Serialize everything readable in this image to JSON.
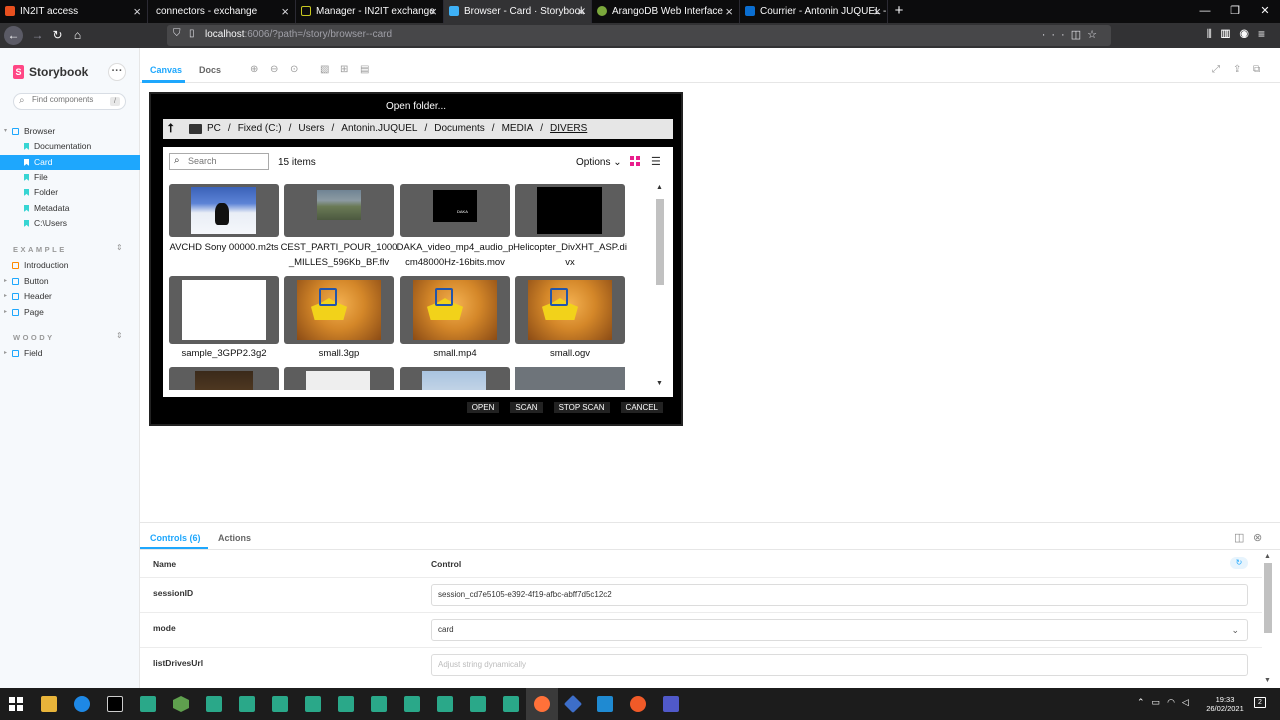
{
  "browser": {
    "tabs": [
      {
        "title": "IN2IT access",
        "color": "#e8501f"
      },
      {
        "title": "connectors - exchange",
        "color": "#0c0c0d"
      },
      {
        "title": "Manager - IN2IT exchange",
        "color": "#c8c820"
      },
      {
        "title": "Browser - Card · Storybook",
        "color": "#3eb1f7"
      },
      {
        "title": "ArangoDB Web Interface",
        "color": "#7ba83c"
      },
      {
        "title": "Courrier - Antonin JUQUEL - O...",
        "color": "#0a6ed1"
      }
    ],
    "url": {
      "host": "localhost",
      "rest": ":6006/?path=/story/browser--card"
    }
  },
  "sidebar": {
    "brand": "Storybook",
    "search_placeholder": "Find components",
    "search_shortcut": "/",
    "items": [
      {
        "label": "Browser",
        "kind": "component"
      },
      {
        "label": "Documentation",
        "kind": "story"
      },
      {
        "label": "Card",
        "kind": "story"
      },
      {
        "label": "File",
        "kind": "story"
      },
      {
        "label": "Folder",
        "kind": "story"
      },
      {
        "label": "Metadata",
        "kind": "story"
      },
      {
        "label": "C:\\Users",
        "kind": "story"
      }
    ],
    "sections": [
      {
        "title": "EXAMPLE",
        "items": [
          "Introduction",
          "Button",
          "Header",
          "Page"
        ]
      },
      {
        "title": "WOODY",
        "items": [
          "Field"
        ]
      }
    ]
  },
  "toolbar": {
    "tabs": [
      "Canvas",
      "Docs"
    ]
  },
  "dialog": {
    "title": "Open folder...",
    "breadcrumb": [
      "PC",
      "Fixed (C:)",
      "Users",
      "Antonin.JUQUEL",
      "Documents",
      "MEDIA",
      "DIVERS"
    ],
    "search_placeholder": "Search",
    "item_count": "15 items",
    "options_label": "Options",
    "files": [
      "AVCHD Sony 00000.m2ts",
      "CEST_PARTI_POUR_1000_MILLES_596Kb_BF.flv",
      "DAKA_video_mp4_audio_pcm48000Hz-16bits.mov",
      "Helicopter_DivXHT_ASP.divx",
      "sample_3GPP2.3g2",
      "small.3gp",
      "small.mp4",
      "small.ogv"
    ],
    "actions": [
      "OPEN",
      "SCAN",
      "STOP SCAN",
      "CANCEL"
    ]
  },
  "addons": {
    "tabs": [
      "Controls (6)",
      "Actions"
    ],
    "headers": {
      "name": "Name",
      "control": "Control"
    },
    "controls": [
      {
        "name": "sessionID",
        "value": "session_cd7e5105-e392-4f19-afbc-abff7d5c12c2",
        "type": "text"
      },
      {
        "name": "mode",
        "value": "card",
        "type": "select"
      },
      {
        "name": "listDrivesUrl",
        "value": "Adjust string dynamically",
        "type": "placeholder"
      }
    ]
  },
  "taskbar": {
    "time": "19:33",
    "date": "26/02/2021"
  }
}
